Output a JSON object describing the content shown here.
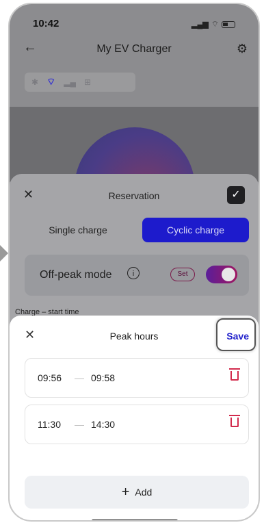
{
  "status": {
    "time": "10:42"
  },
  "header": {
    "title": "My EV Charger"
  },
  "reservation": {
    "title": "Reservation",
    "tabs": [
      {
        "label": "Single charge"
      },
      {
        "label": "Cyclic charge"
      }
    ],
    "offpeak_label": "Off-peak mode",
    "set_label": "Set",
    "charge_start_label": "Charge – start time"
  },
  "peak_hours": {
    "title": "Peak hours",
    "save_label": "Save",
    "ranges": [
      {
        "from": "09:56",
        "to": "09:58"
      },
      {
        "from": "11:30",
        "to": "14:30"
      }
    ],
    "add_label": "Add"
  },
  "icons": {
    "back": "back-arrow-icon",
    "settings": "gear-icon",
    "close": "close-icon",
    "check": "check-icon",
    "info": "info-icon",
    "delete": "trash-icon",
    "add": "plus-icon"
  },
  "colors": {
    "accent": "#2424cc",
    "delete": "#d22a4c"
  }
}
